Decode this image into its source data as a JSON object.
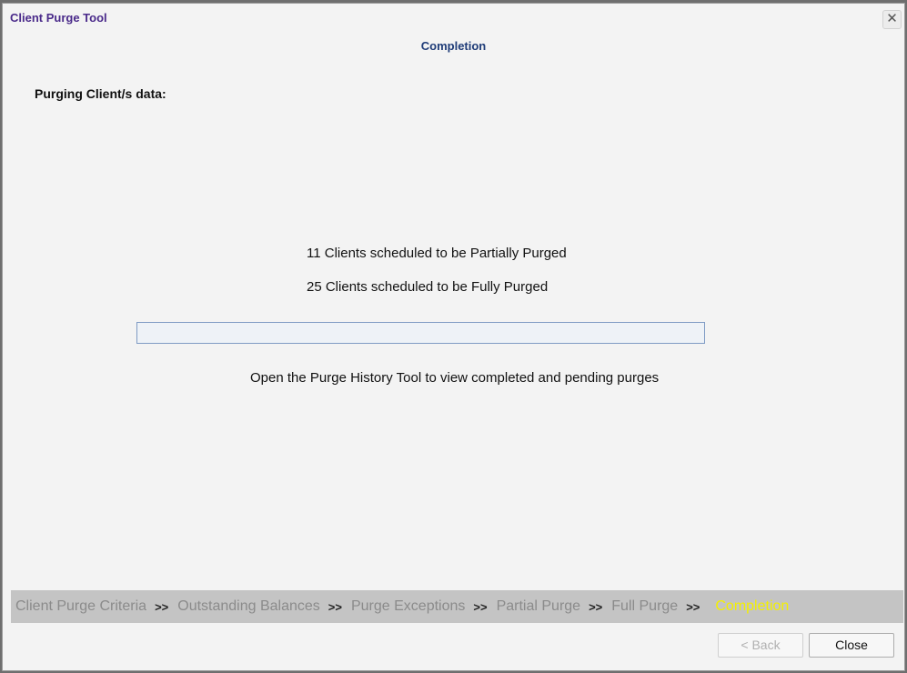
{
  "window": {
    "title": "Client Purge Tool"
  },
  "step_heading": "Completion",
  "section_label": "Purging Client/s data:",
  "messages": {
    "partial": "11 Clients scheduled to be Partially Purged",
    "full": "25 Clients scheduled to be Fully Purged",
    "history": "Open the Purge History Tool to view completed and pending purges"
  },
  "progress": {
    "value": 0
  },
  "steps": {
    "separator": ">>",
    "items": [
      "Client Purge Criteria",
      "Outstanding Balances",
      "Purge Exceptions",
      "Partial Purge",
      "Full Purge",
      "Completion"
    ],
    "current": "Completion"
  },
  "buttons": {
    "back": "< Back",
    "close": "Close"
  },
  "colors": {
    "title": "#4a2a8a",
    "heading": "#1f3c78",
    "current_step": "#f4f000",
    "inactive_step": "#8b8b8b",
    "step_bar": "#c4c4c4"
  },
  "icons": {
    "close": "close-icon"
  }
}
